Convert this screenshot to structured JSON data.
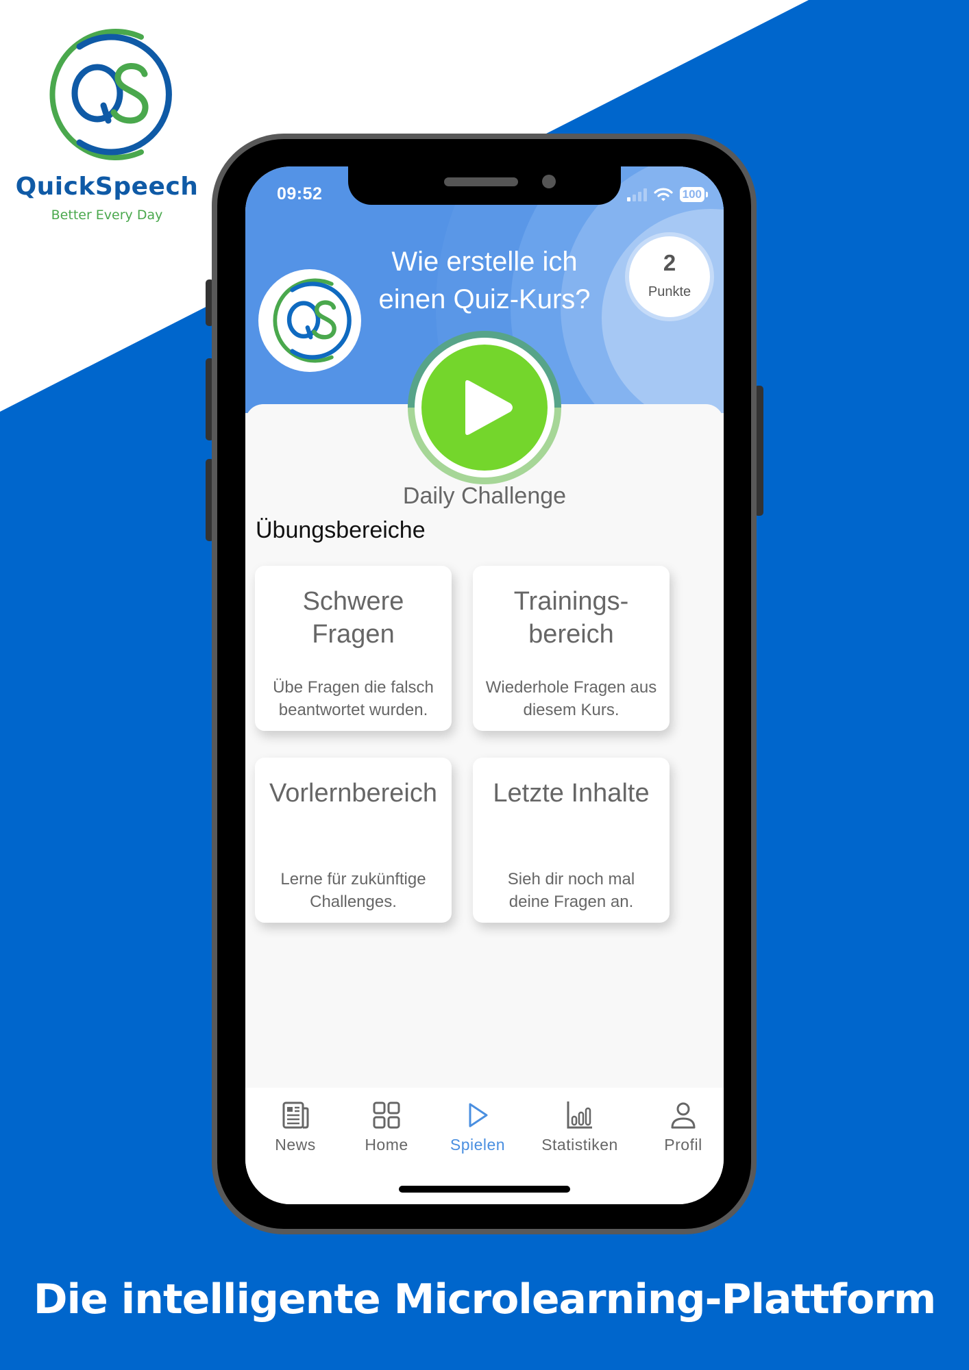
{
  "brand": {
    "name": "QuickSpeech",
    "tagline": "Better Every Day",
    "logo_letters": "QS",
    "colors": {
      "blue": "#0f5aa6",
      "green": "#4aa84d",
      "background_blue": "#0066cc"
    }
  },
  "status_bar": {
    "time": "09:52",
    "icons": [
      "signal-icon",
      "wifi-icon",
      "battery-icon"
    ],
    "battery_level": "100"
  },
  "header": {
    "course_title_line1": "Wie erstelle ich",
    "course_title_line2": "einen Quiz-Kurs?",
    "points": {
      "value": "2",
      "label": "Punkte"
    },
    "color": "#5493e6"
  },
  "daily_challenge": {
    "label": "Daily Challenge",
    "icon": "play-icon",
    "color": "#74d62c"
  },
  "practice_areas": {
    "title": "Übungsbereiche",
    "tiles": [
      {
        "title": "Schwere Fragen",
        "description": "Übe Fragen die falsch beantwortet wurden."
      },
      {
        "title": "Trainings-bereich",
        "description": "Wiederhole Fragen aus diesem Kurs."
      },
      {
        "title": "Vorlernbereich",
        "description": "Lerne für zukünftige Challenges."
      },
      {
        "title": "Letzte Inhalte",
        "description": "Sieh dir noch mal deine Fragen an."
      }
    ]
  },
  "tabbar": {
    "active": "Spielen",
    "active_color": "#4a8fe0",
    "items": [
      {
        "label": "News",
        "icon": "newspaper-icon"
      },
      {
        "label": "Home",
        "icon": "grid-icon"
      },
      {
        "label": "Spielen",
        "icon": "play-icon"
      },
      {
        "label": "Statistiken",
        "icon": "bar-chart-icon"
      },
      {
        "label": "Profil",
        "icon": "user-icon"
      }
    ]
  },
  "footer": {
    "tagline": "Die intelligente Microlearning-Plattform"
  }
}
